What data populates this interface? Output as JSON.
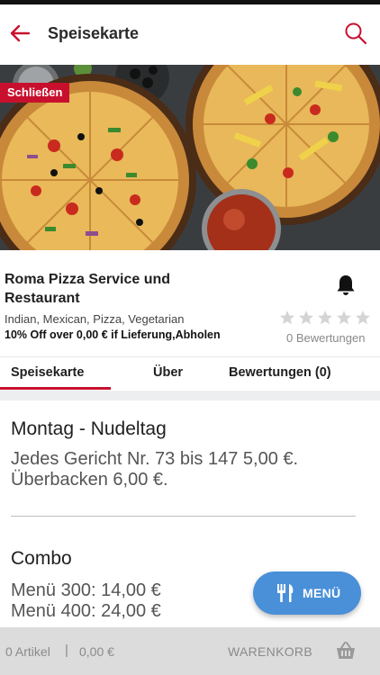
{
  "header": {
    "title": "Speisekarte",
    "back_icon": "arrow-back-icon",
    "search_icon": "search-icon",
    "accent_color": "#c8102e"
  },
  "hero": {
    "status_badge": "Schließen",
    "badge_color": "#c8102e"
  },
  "restaurant": {
    "name": "Roma Pizza Service und Restaurant",
    "cuisines": "Indian, Mexican, Pizza, Vegetarian",
    "offer": "10% Off over 0,00 € if Lieferung,Abholen",
    "rating_stars": 0,
    "rating_max": 5,
    "rating_count": "0 Bewertungen",
    "notify_icon": "bell-icon"
  },
  "tabs": [
    {
      "label": "Speisekarte",
      "active": true
    },
    {
      "label": "Über",
      "active": false
    },
    {
      "label": "Bewertungen (0)",
      "active": false
    }
  ],
  "menu_sections": [
    {
      "title": "Montag - Nudeltag",
      "body": "Jedes Gericht Nr. 73 bis 147 5,00 €. Überbacken 6,00 €."
    },
    {
      "title": "Combo",
      "line1": "Menü 300: 14,00 €",
      "line2": "Menü 400: 24,00 €"
    }
  ],
  "fab": {
    "label": "MENÜ",
    "icon": "fork-knife-icon",
    "color": "#4a90d9"
  },
  "cart": {
    "items": "0 Artikel",
    "separator": "|",
    "total": "0,00 €",
    "label": "WARENKORB",
    "icon": "basket-icon"
  }
}
